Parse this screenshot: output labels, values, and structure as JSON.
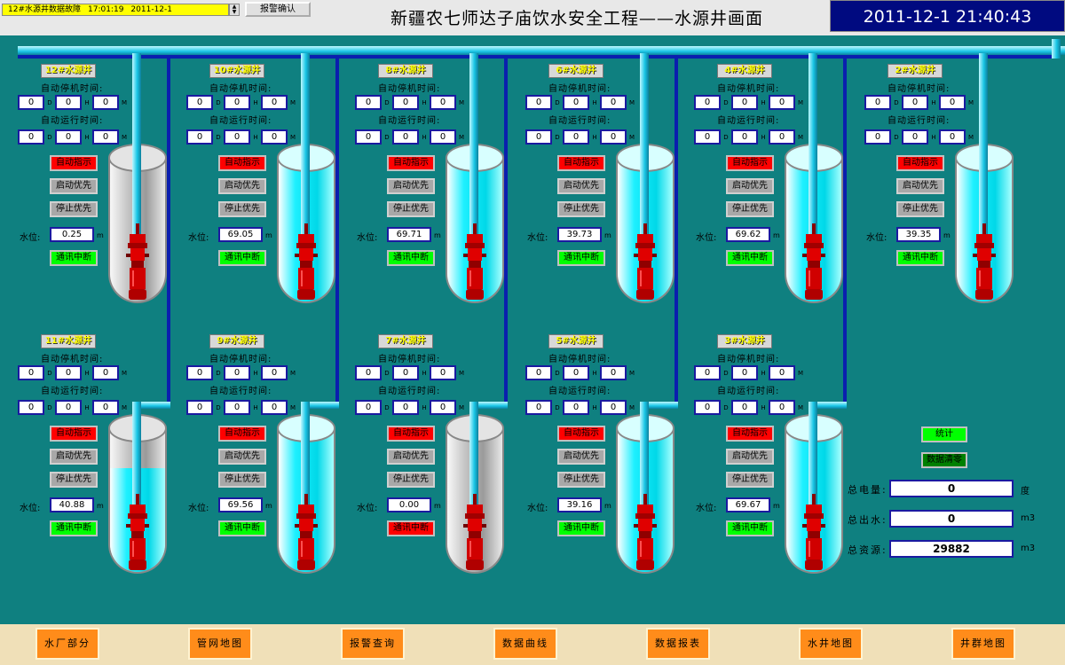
{
  "header": {
    "alarm_text": "12#水源井数据故障",
    "alarm_time": "17:01:19",
    "alarm_date": "2011-12-1",
    "ack_label": "报警确认",
    "title": "新疆农七师达子庙饮水安全工程——水源井画面",
    "clock": "2011-12-1 21:40:43"
  },
  "labels": {
    "stop_time": "自动停机时间:",
    "run_time": "自动运行时间:",
    "water_level": "水位:",
    "unit_d": "D",
    "unit_h": "H",
    "unit_m": "M",
    "level_unit": "m",
    "auto_indicator": "自动指示",
    "start_priority": "启动优先",
    "stop_priority": "停止优先",
    "comm_interrupt": "通讯中断"
  },
  "wells": [
    {
      "name": "12#水源井",
      "stop": [
        "0",
        "0",
        "0"
      ],
      "run": [
        "0",
        "0",
        "0"
      ],
      "level": "0.25",
      "tank": "empty",
      "comm_ok": true
    },
    {
      "name": "10#水源井",
      "stop": [
        "0",
        "0",
        "0"
      ],
      "run": [
        "0",
        "0",
        "0"
      ],
      "level": "69.05",
      "tank": "full",
      "comm_ok": true
    },
    {
      "name": "8#水源井",
      "stop": [
        "0",
        "0",
        "0"
      ],
      "run": [
        "0",
        "0",
        "0"
      ],
      "level": "69.71",
      "tank": "full",
      "comm_ok": true
    },
    {
      "name": "6#水源井",
      "stop": [
        "0",
        "0",
        "0"
      ],
      "run": [
        "0",
        "0",
        "0"
      ],
      "level": "39.73",
      "tank": "full",
      "comm_ok": true
    },
    {
      "name": "4#水源井",
      "stop": [
        "0",
        "0",
        "0"
      ],
      "run": [
        "0",
        "0",
        "0"
      ],
      "level": "69.62",
      "tank": "full",
      "comm_ok": true
    },
    {
      "name": "2#水源井",
      "stop": [
        "0",
        "0",
        "0"
      ],
      "run": [
        "0",
        "0",
        "0"
      ],
      "level": "39.35",
      "tank": "full",
      "comm_ok": true
    },
    {
      "name": "11#水源井",
      "stop": [
        "0",
        "0",
        "0"
      ],
      "run": [
        "0",
        "0",
        "0"
      ],
      "level": "40.88",
      "tank": "half",
      "comm_ok": true
    },
    {
      "name": "9#水源井",
      "stop": [
        "0",
        "0",
        "0"
      ],
      "run": [
        "0",
        "0",
        "0"
      ],
      "level": "69.56",
      "tank": "full",
      "comm_ok": true
    },
    {
      "name": "7#水源井",
      "stop": [
        "0",
        "0",
        "0"
      ],
      "run": [
        "0",
        "0",
        "0"
      ],
      "level": "0.00",
      "tank": "empty",
      "comm_ok": false
    },
    {
      "name": "5#水源井",
      "stop": [
        "0",
        "0",
        "0"
      ],
      "run": [
        "0",
        "0",
        "0"
      ],
      "level": "39.16",
      "tank": "full",
      "comm_ok": true
    },
    {
      "name": "3#水源井",
      "stop": [
        "0",
        "0",
        "0"
      ],
      "run": [
        "0",
        "0",
        "0"
      ],
      "level": "69.67",
      "tank": "full",
      "comm_ok": true
    }
  ],
  "totals": {
    "stat_label": "统计",
    "clear_label": "数据清零",
    "power_label": "总电量:",
    "power_value": "0",
    "power_unit": "度",
    "water_label": "总出水:",
    "water_value": "0",
    "water_unit": "m3",
    "resource_label": "总资源:",
    "resource_value": "29882",
    "resource_unit": "m3"
  },
  "nav": [
    "水厂部分",
    "管网地图",
    "报警查询",
    "数据曲线",
    "数据报表",
    "水井地图",
    "井群地图"
  ],
  "colors": {
    "background": "#0f8080",
    "water": "#1ef0ff",
    "alarm_red": "#ff0000",
    "ok_green": "#00ff00",
    "nav_orange": "#ff8c1a"
  }
}
